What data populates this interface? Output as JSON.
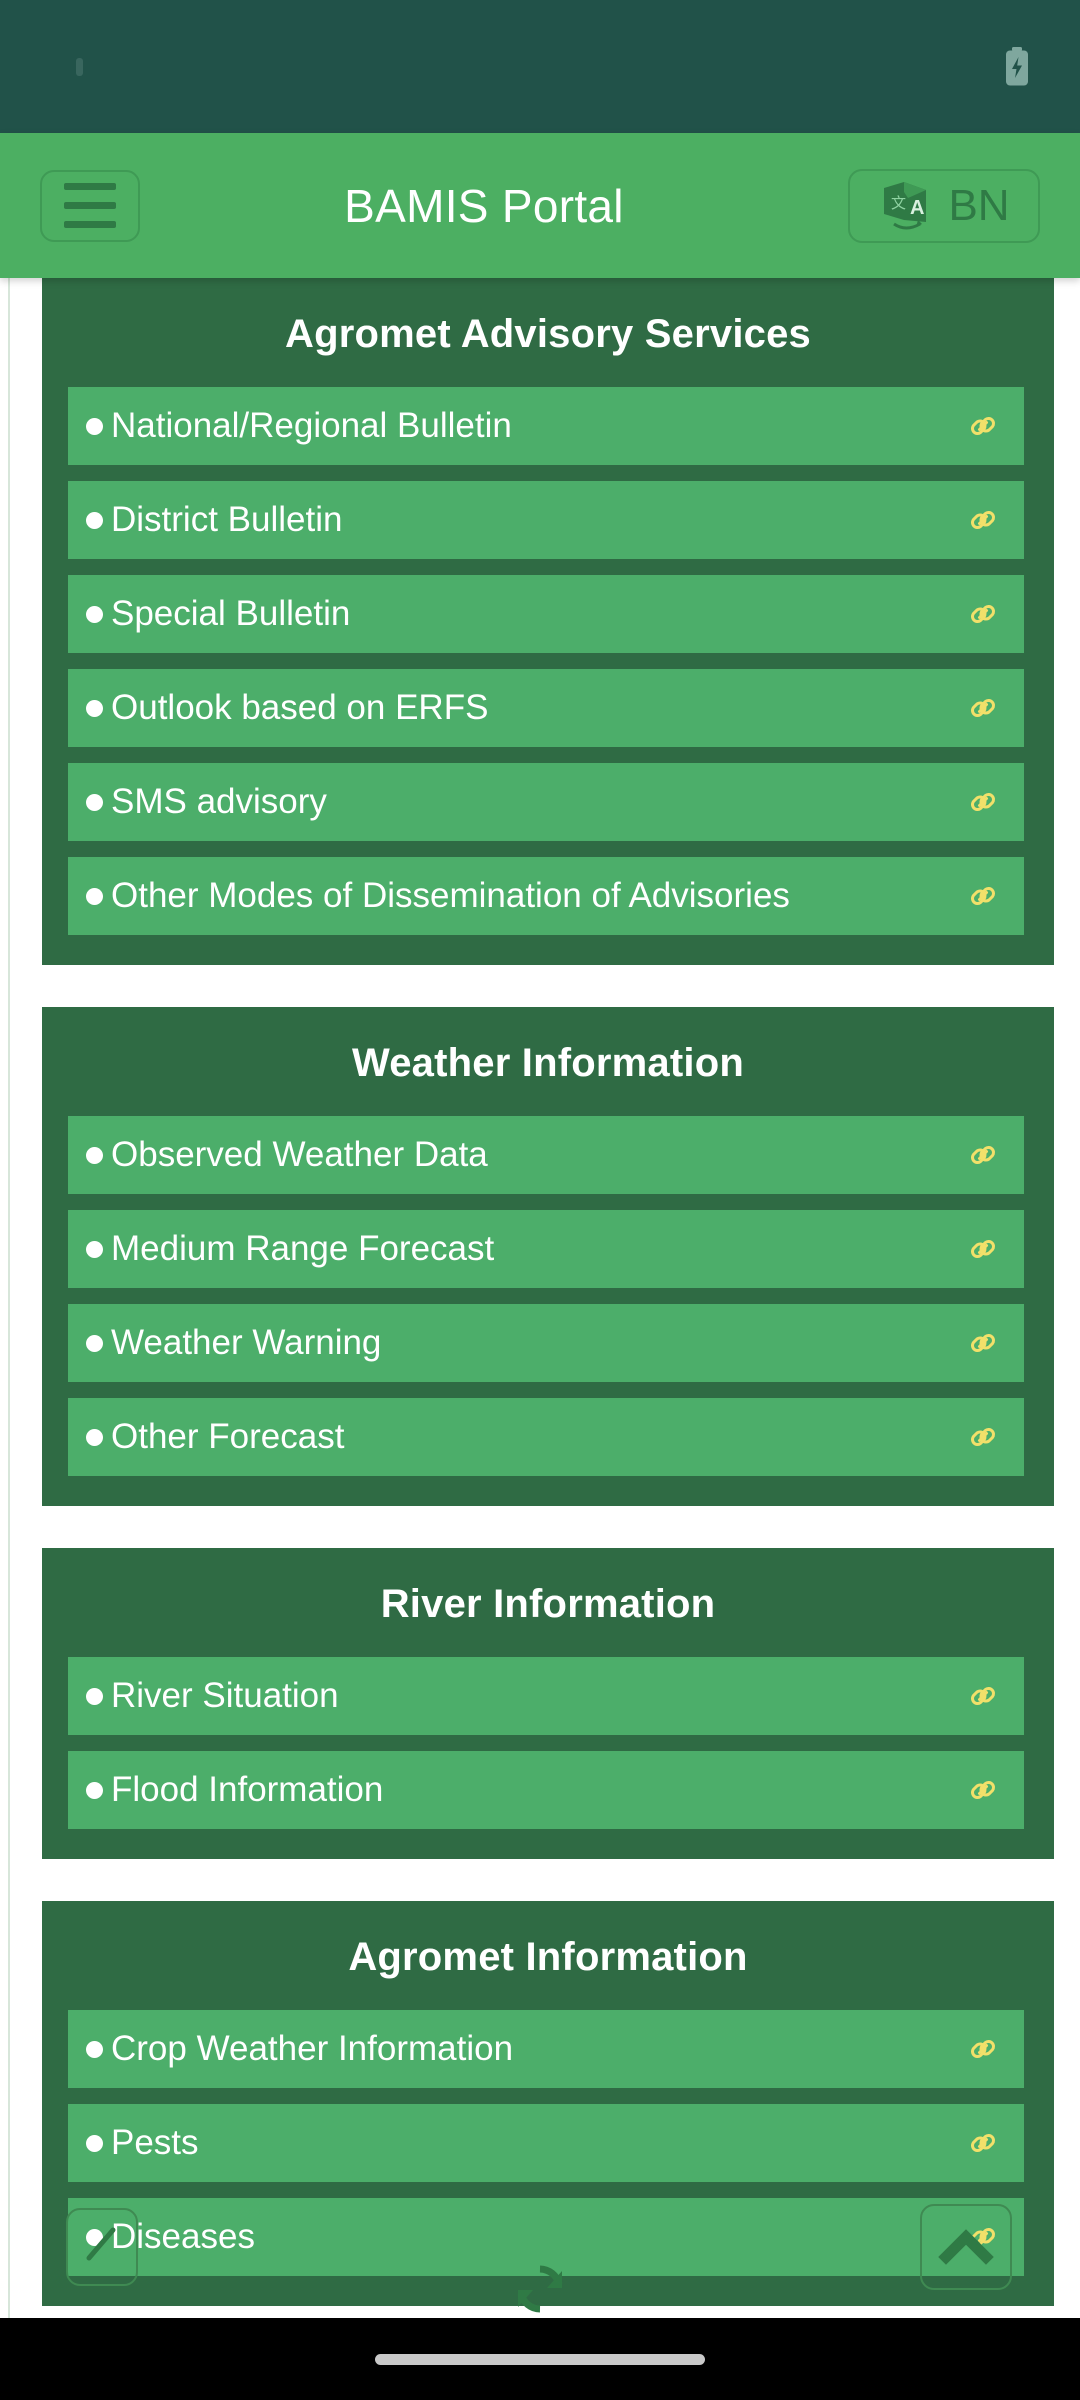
{
  "status_bar": {
    "battery_icon": "battery-charging-icon",
    "notification_dot": "notification-dot"
  },
  "app_bar": {
    "menu_icon": "hamburger-menu-icon",
    "title": "BAMIS Portal",
    "language": {
      "icon": "translate-icon",
      "code": "BN"
    }
  },
  "colors": {
    "status_bar_bg": "#215249",
    "app_bar_bg": "#4CAF62",
    "card_bg": "#2F6B44",
    "row_bg": "#4CAE6A",
    "link_icon": "#F2E06A",
    "text_on_green": "#FFFFFF",
    "icon_dark_green": "#2F7A45",
    "nav_bar_bg": "#000000"
  },
  "sections": [
    {
      "title": "Agromet Advisory Services",
      "items": [
        {
          "label": "National/Regional Bulletin",
          "icon": "link-icon"
        },
        {
          "label": "District Bulletin",
          "icon": "link-icon"
        },
        {
          "label": "Special Bulletin",
          "icon": "link-icon"
        },
        {
          "label": "Outlook based on ERFS",
          "icon": "link-icon"
        },
        {
          "label": "SMS advisory",
          "icon": "link-icon"
        },
        {
          "label": "Other Modes of Dissemination of Advisories",
          "icon": "link-icon"
        }
      ]
    },
    {
      "title": "Weather Information",
      "items": [
        {
          "label": "Observed Weather Data",
          "icon": "link-icon"
        },
        {
          "label": "Medium Range Forecast",
          "icon": "link-icon"
        },
        {
          "label": "Weather Warning",
          "icon": "link-icon"
        },
        {
          "label": "Other Forecast",
          "icon": "link-icon"
        }
      ]
    },
    {
      "title": "River Information",
      "items": [
        {
          "label": "River Situation",
          "icon": "link-icon"
        },
        {
          "label": "Flood Information",
          "icon": "link-icon"
        }
      ]
    },
    {
      "title": "Agromet Information",
      "items": [
        {
          "label": "Crop Weather Information",
          "icon": "link-icon"
        },
        {
          "label": "Pests",
          "icon": "link-icon"
        },
        {
          "label": "Diseases",
          "icon": "link-icon"
        }
      ]
    }
  ],
  "floating_controls": {
    "back_icon": "back-arrow-icon",
    "refresh_icon": "refresh-icon",
    "scroll_top_icon": "chevron-up-icon"
  },
  "nav_bar": {
    "home_indicator": "home-indicator-pill"
  }
}
